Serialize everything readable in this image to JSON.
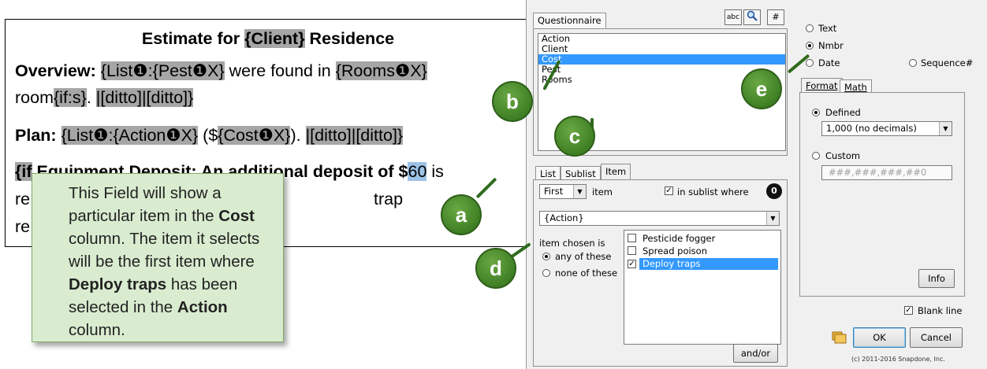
{
  "document": {
    "title_prefix": "Estimate for ",
    "title_field": "{Client}",
    "title_suffix": " Residence",
    "overview_label": "Overview:",
    "overview_pre": " ",
    "overview_f1": "{List❶:{Pest❶X}",
    "overview_mid": " were found in ",
    "overview_f2": "{Rooms❶X}",
    "line2_pre": "room",
    "line2_f1": "{if:s}",
    "line2_mid": ". ",
    "line2_f2": "|[ditto]|[ditto]}",
    "plan_label": "Plan:",
    "plan_pre": " ",
    "plan_f1": "{List❶:{Action❶X}",
    "plan_mid1": " ($",
    "plan_f2": "{Cost❶X}",
    "plan_mid2": "). ",
    "plan_f3": "|[ditto]|[ditto]}",
    "line4_f1": "{if",
    "line4_rest": " Equipment Deposit: An additional deposit of $",
    "line4_sel": "60",
    "line4_tail": " is",
    "line5_pre": "re",
    "line5_trap": "trap",
    "line6_pre": "re"
  },
  "callout": {
    "p1": "This Field will show a particular item in the ",
    "p1_bold": "Cost",
    "p2": " column. The item it selects will be the first item where ",
    "p2_bold": "Deploy traps",
    "p3": " has been selected in the ",
    "p3_bold": "Action",
    "p4": " column."
  },
  "bubbles": {
    "a": "a",
    "b": "b",
    "c": "c",
    "d": "d",
    "e": "e"
  },
  "dialog": {
    "questionnaire_tab": "Questionnaire",
    "toolbar": {
      "abc": "abc",
      "search_icon": "magnifier",
      "hash": "#"
    },
    "fields": [
      "Action",
      "Client",
      "Cost",
      "Pest",
      "Rooms"
    ],
    "selected_field": "Cost",
    "lower_tabs": [
      "List",
      "Sublist",
      "Item"
    ],
    "item_position": "First",
    "item_label": "item",
    "in_sublist_label": "in sublist where",
    "sublist_number": "0",
    "action_combo": "{Action}",
    "item_chosen_is": "item chosen is",
    "any_of_these": "any of these",
    "none_of_these": "none of these",
    "options": [
      {
        "label": "Pesticide fogger",
        "checked": false,
        "selected": false
      },
      {
        "label": "Spread poison",
        "checked": false,
        "selected": false
      },
      {
        "label": "Deploy traps",
        "checked": true,
        "selected": true
      }
    ],
    "and_or": "and/or",
    "type_radios": {
      "text": "Text",
      "nmbr": "Nmbr",
      "date": "Date",
      "sequence": "Sequence#"
    },
    "format_tabs": [
      "Format",
      "Math"
    ],
    "defined_label": "Defined",
    "defined_value": "1,000 (no decimals)",
    "custom_label": "Custom",
    "custom_placeholder": "###,###,###,##0",
    "info_button": "Info",
    "blank_line": "Blank line",
    "ok": "OK",
    "cancel": "Cancel",
    "copyright": "(c) 2011-2016 Snapdone, Inc."
  }
}
